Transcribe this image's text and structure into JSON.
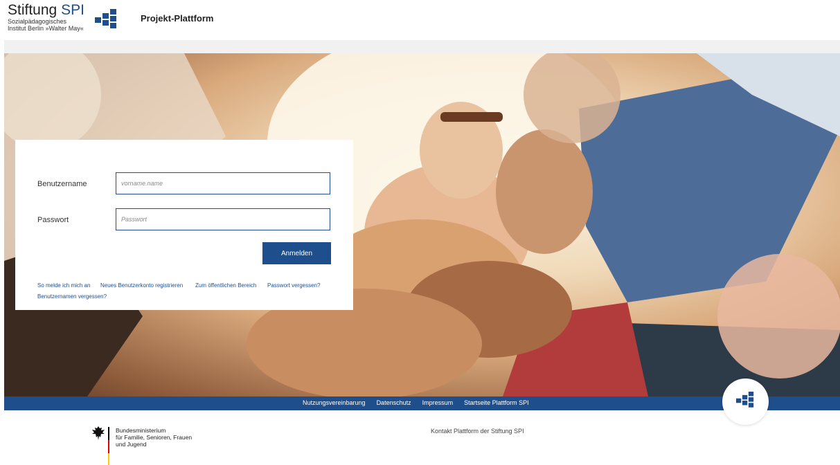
{
  "header": {
    "logo_main": "Stiftung",
    "logo_accent": "SPI",
    "logo_sub_line1": "Sozialpädagogisches",
    "logo_sub_line2": "Institut Berlin »Walter May«",
    "title": "Projekt-Plattform"
  },
  "login": {
    "username_label": "Benutzername",
    "username_placeholder": "vorname.name",
    "password_label": "Passwort",
    "password_placeholder": "Passwort",
    "submit_label": "Anmelden",
    "links": [
      "So melde ich mich an",
      "Neues Benutzerkonto registrieren",
      "Zum öffentlichen Bereich",
      "Passwort vergessen?",
      "Benutzernamen vergessen?"
    ]
  },
  "footer": {
    "nav": [
      "Nutzungsvereinbarung",
      "Datenschutz",
      "Impressum",
      "Startseite Plattform SPI"
    ],
    "ministry_line1": "Bundesministerium",
    "ministry_line2": "für Familie, Senioren, Frauen",
    "ministry_line3": "und Jugend",
    "contact": "Kontakt Plattform der Stiftung SPI"
  },
  "colors": {
    "brand_blue": "#1f4e8c",
    "footer_bar": "#1f4e8c",
    "background": "#ffffff"
  },
  "icons": [
    "spi-logo-icon",
    "spi-badge-icon",
    "federal-eagle-icon"
  ]
}
